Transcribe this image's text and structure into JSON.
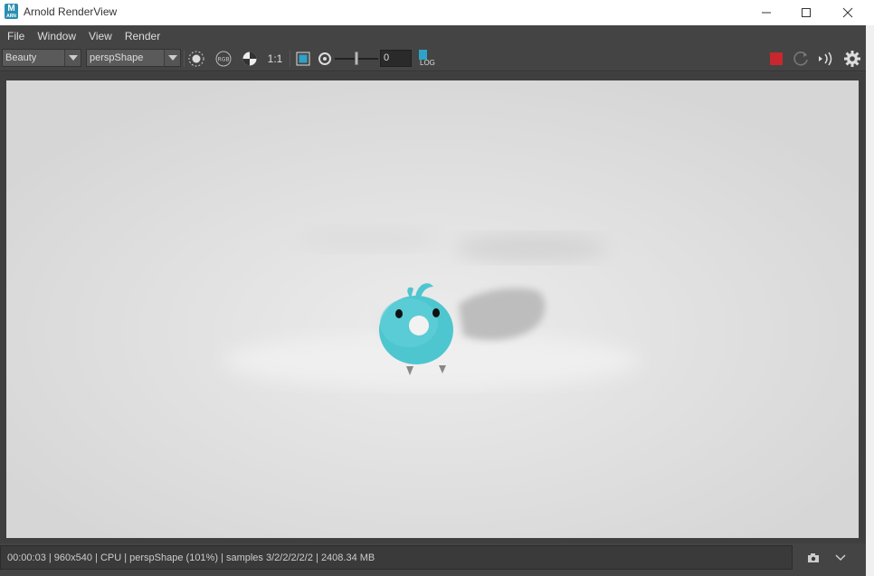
{
  "window": {
    "title": "Arnold RenderView",
    "icon_letter": "M",
    "icon_sub": "ARN"
  },
  "menu": [
    "File",
    "Window",
    "View",
    "Render"
  ],
  "toolbar": {
    "aov_value": "Beauty",
    "camera_value": "perspShape",
    "ratio_label": "1:1",
    "exposure_value": "0",
    "log_label": "LOG",
    "icons": [
      "crosshair-icon",
      "rgb-icon",
      "checker-icon",
      "frame-icon",
      "aperture-icon",
      "stop-render-icon",
      "refresh-icon",
      "ipr-icon",
      "settings-icon"
    ],
    "stop_color": "#c8282d",
    "accent_color": "#2ea2c7"
  },
  "status": {
    "text": "00:00:03 | 960x540 | CPU | perspShape (101%) | samples 3/2/2/2/2/2 | 2408.34 MB"
  },
  "render": {
    "background_color": "#d9d9d9",
    "subject_color": "#4ec6cf"
  }
}
